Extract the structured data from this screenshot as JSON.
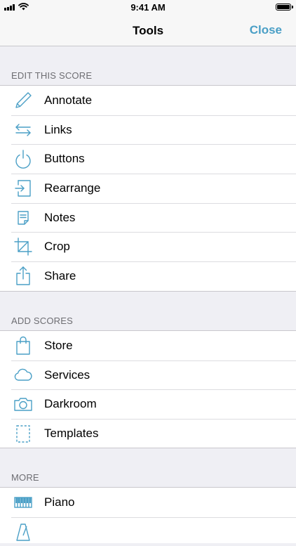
{
  "status_bar": {
    "time": "9:41 AM"
  },
  "nav": {
    "title": "Tools",
    "close_label": "Close"
  },
  "accent_color": "#4a9fc6",
  "sections": [
    {
      "header": "EDIT THIS SCORE",
      "items": [
        {
          "label": "Annotate",
          "icon": "pencil-icon"
        },
        {
          "label": "Links",
          "icon": "links-arrows-icon"
        },
        {
          "label": "Buttons",
          "icon": "power-button-icon"
        },
        {
          "label": "Rearrange",
          "icon": "rearrange-icon"
        },
        {
          "label": "Notes",
          "icon": "notes-icon"
        },
        {
          "label": "Crop",
          "icon": "crop-icon"
        },
        {
          "label": "Share",
          "icon": "share-icon"
        }
      ]
    },
    {
      "header": "ADD SCORES",
      "items": [
        {
          "label": "Store",
          "icon": "shopping-bag-icon"
        },
        {
          "label": "Services",
          "icon": "cloud-icon"
        },
        {
          "label": "Darkroom",
          "icon": "camera-icon"
        },
        {
          "label": "Templates",
          "icon": "dashed-page-icon"
        }
      ]
    },
    {
      "header": "MORE",
      "items": [
        {
          "label": "Piano",
          "icon": "piano-keyboard-icon"
        }
      ]
    }
  ]
}
